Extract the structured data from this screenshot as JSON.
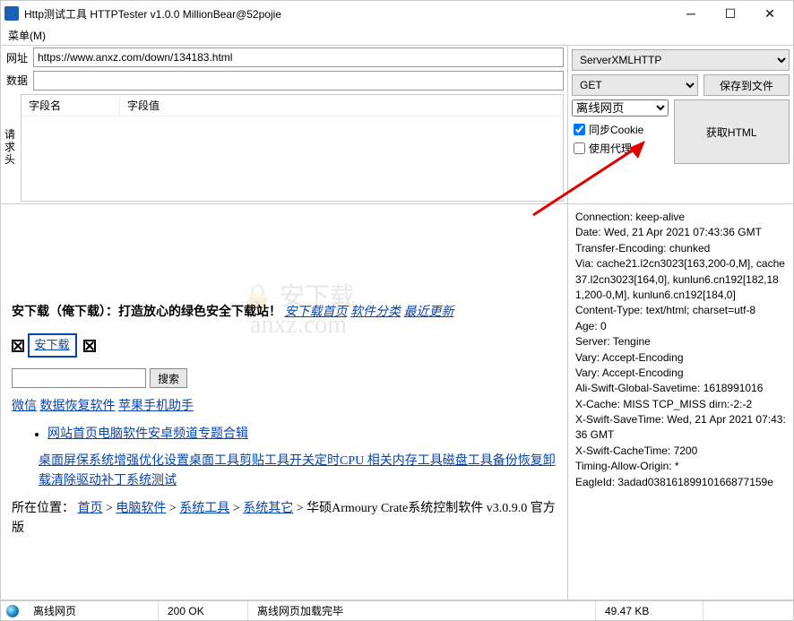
{
  "window": {
    "title": "Http测试工具 HTTPTester v1.0.0    MillionBear@52pojie",
    "menu": "菜单(M)"
  },
  "form": {
    "url_label": "网址",
    "url_value": "https://www.anxz.com/down/134183.html",
    "data_label": "数据",
    "data_value": "",
    "side_label": "请求头",
    "col_name": "字段名",
    "col_value": "字段值"
  },
  "right": {
    "server_select": "ServerXMLHTTP",
    "method": "GET",
    "save_btn": "保存到文件",
    "page_select": "离线网页",
    "sync_cookie": "同步Cookie",
    "use_proxy": "使用代理",
    "get_html": "获取HTML"
  },
  "preview": {
    "headline": "安下载（俺下载）：打造放心的绿色安全下载站！",
    "nav1": "安下载首页",
    "nav2": "软件分类",
    "nav3": "最近更新",
    "box_btn": "安下载",
    "search_btn": "搜索",
    "links_row": [
      "微信",
      "数据恢复软件",
      "苹果手机助手"
    ],
    "bullet": "网站首页电脑软件安卓频道专题合辑",
    "long_link": "桌面屏保系统增强优化设置桌面工具剪贴工具开关定时CPU 相关内存工具磁盘工具备份恢复卸载清除驱动补丁系统测试",
    "breadcrumb_label": "所在位置：",
    "bc1": "首页",
    "bc2": "电脑软件",
    "bc3": "系统工具",
    "bc4": "系统其它",
    "bc_tail": "华硕Armoury Crate系统控制软件  v3.0.9.0 官方版",
    "watermark": "安下载\nanxz.com"
  },
  "headers_text": "Connection: keep-alive\nDate: Wed, 21 Apr 2021 07:43:36 GMT\nTransfer-Encoding: chunked\nVia: cache21.l2cn3023[163,200-0,M], cache37.l2cn3023[164,0], kunlun6.cn192[182,181,200-0,M], kunlun6.cn192[184,0]\nContent-Type: text/html; charset=utf-8\nAge: 0\nServer: Tengine\nVary: Accept-Encoding\nVary: Accept-Encoding\nAli-Swift-Global-Savetime: 1618991016\nX-Cache: MISS TCP_MISS dirn:-2:-2\nX-Swift-SaveTime: Wed, 21 Apr 2021 07:43:36 GMT\nX-Swift-CacheTime: 7200\nTiming-Allow-Origin: *\nEagleId: 3adad03816189910166877159e",
  "status": {
    "mode": "离线网页",
    "code": "200 OK",
    "msg": "离线网页加载完毕",
    "size": "49.47 KB"
  }
}
